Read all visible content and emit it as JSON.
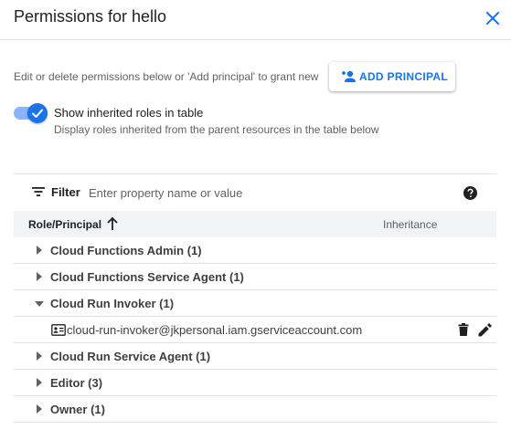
{
  "dialog": {
    "title": "Permissions for hello",
    "close_icon": "close-icon"
  },
  "intro": {
    "text": "Edit or delete permissions below or 'Add principal' to grant new",
    "add_button_label": "ADD PRINCIPAL",
    "add_button_icon": "person-add-icon"
  },
  "toggle": {
    "checked": true,
    "label": "Show inherited roles in table",
    "sublabel": "Display roles inherited from the parent resources in the table below"
  },
  "filter": {
    "label": "Filter",
    "placeholder": "Enter property name or value",
    "value": "",
    "help_icon": "help-icon"
  },
  "table": {
    "columns": [
      "Role/Principal",
      "Inheritance"
    ],
    "sort_direction": "ascending",
    "rows": [
      {
        "label": "Cloud Functions Admin (1)",
        "expanded": false
      },
      {
        "label": "Cloud Functions Service Agent (1)",
        "expanded": false
      },
      {
        "label": "Cloud Run Invoker (1)",
        "expanded": true
      },
      {
        "label": "Cloud Run Service Agent (1)",
        "expanded": false
      },
      {
        "label": "Editor (3)",
        "expanded": false
      },
      {
        "label": "Owner (1)",
        "expanded": false
      }
    ],
    "member": {
      "label": "cloud-run-invoker@jkpersonal.iam.gserviceaccount.com",
      "icon": "service-account-icon"
    }
  },
  "colors": {
    "accent": "#1a73e8",
    "toggle_track": "#8ab4f8",
    "header_bg": "#f1f3f4",
    "divider": "#e0e0e0"
  }
}
